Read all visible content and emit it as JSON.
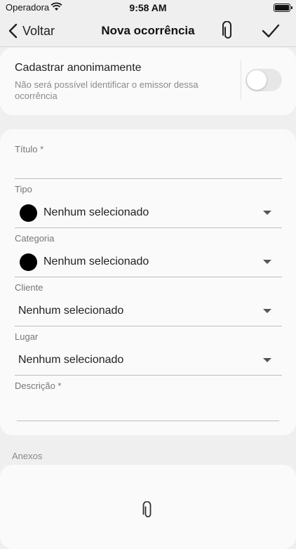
{
  "status_bar": {
    "carrier": "Operadora",
    "time": "9:58 AM"
  },
  "nav": {
    "back_label": "Voltar",
    "title": "Nova ocorrência"
  },
  "anonymous": {
    "title": "Cadastrar anonimamente",
    "description": "Não será possível identificar o emissor dessa ocorrência",
    "enabled": false
  },
  "form": {
    "titulo": {
      "label": "Título *",
      "value": ""
    },
    "tipo": {
      "label": "Tipo",
      "value": "Nenhum selecionado"
    },
    "categoria": {
      "label": "Categoria",
      "value": "Nenhum selecionado"
    },
    "cliente": {
      "label": "Cliente",
      "value": "Nenhum selecionado"
    },
    "lugar": {
      "label": "Lugar",
      "value": "Nenhum selecionado"
    },
    "descricao": {
      "label": "Descrição *",
      "value": ""
    }
  },
  "attachments": {
    "label": "Anexos"
  },
  "icons": {
    "back": "chevron-left-icon",
    "attach": "paperclip-icon",
    "confirm": "checkmark-icon",
    "wifi": "wifi-icon",
    "battery": "battery-icon",
    "dropdown": "caret-down-icon",
    "color_dot": "color-dot-icon"
  },
  "colors": {
    "background": "#efefef",
    "card": "#fafafa",
    "dot": "#000000"
  }
}
